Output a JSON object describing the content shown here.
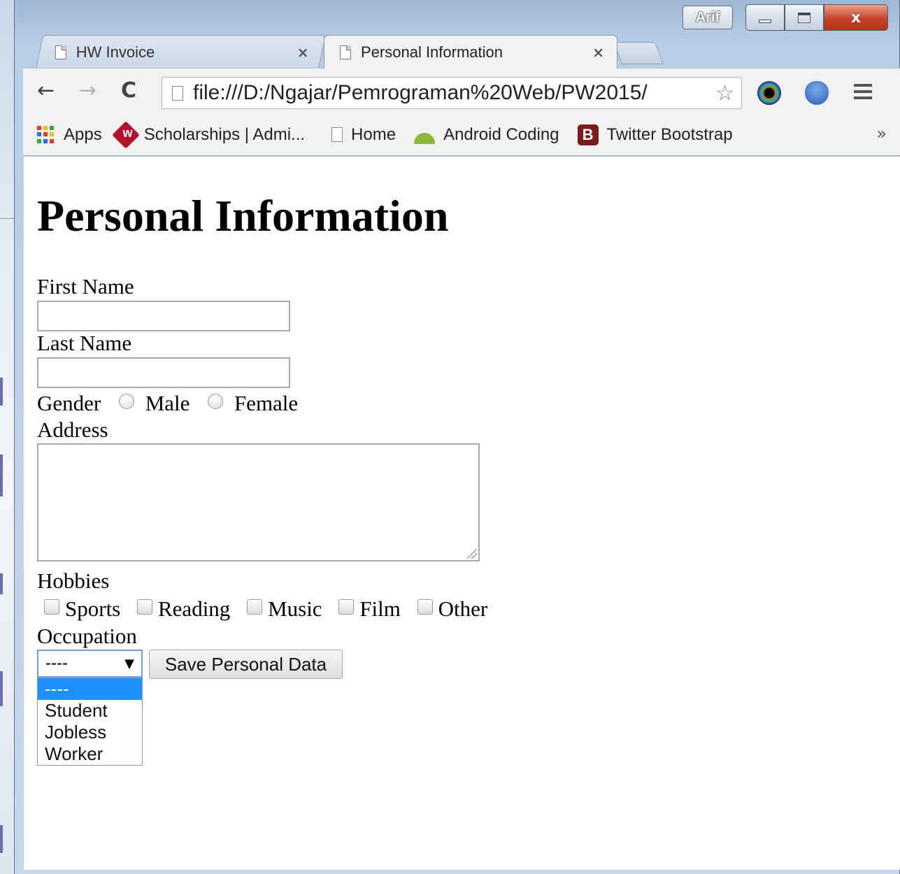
{
  "window": {
    "user": "Arif",
    "controls": {
      "minimize_icon": "minimize-icon",
      "maximize_icon": "maximize-icon",
      "close_glyph": "x"
    }
  },
  "tabs": [
    {
      "label": "HW Invoice",
      "close": "×",
      "active": false
    },
    {
      "label": "Personal Information",
      "close": "×",
      "active": true
    }
  ],
  "toolbar": {
    "back": "←",
    "forward": "→",
    "reload": "C",
    "url": "file:///D:/Ngajar/Pemrograman%20Web/PW2015/",
    "star": "☆",
    "icons": [
      "page-icon",
      "star-icon",
      "camera-extension-icon",
      "download-extension-icon",
      "menu-icon"
    ]
  },
  "bookmarks": [
    {
      "label": "Apps",
      "icon": "apps-icon"
    },
    {
      "label": "Scholarships | Admi...",
      "icon": "scholarships-icon"
    },
    {
      "label": "Home",
      "icon": "page-icon"
    },
    {
      "label": "Android Coding",
      "icon": "android-icon"
    },
    {
      "label": "Twitter Bootstrap",
      "icon": "bootstrap-icon"
    }
  ],
  "bookmarks_more": "»",
  "form": {
    "title": "Personal Information",
    "first_name_label": "First Name",
    "first_name_value": "",
    "last_name_label": "Last Name",
    "last_name_value": "",
    "gender_label": "Gender",
    "gender_options": [
      "Male",
      "Female"
    ],
    "address_label": "Address",
    "address_value": "",
    "hobbies_label": "Hobbies",
    "hobbies": [
      "Sports",
      "Reading",
      "Music",
      "Film",
      "Other"
    ],
    "occupation_label": "Occupation",
    "occupation_selected": "----",
    "occupation_caret": "▼",
    "occupation_options": [
      "----",
      "Student",
      "Jobless",
      "Worker"
    ],
    "save_label": "Save Personal Data"
  }
}
